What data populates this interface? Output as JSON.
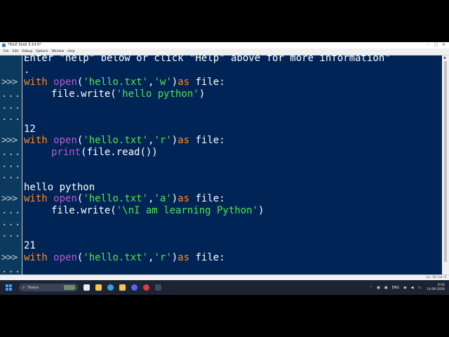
{
  "window": {
    "title": "*IDLE Shell 3.14.0*",
    "controls": [
      "–",
      "□",
      "✕"
    ]
  },
  "menu": [
    "File",
    "Edit",
    "Debug",
    "Options",
    "Window",
    "Help"
  ],
  "shell": {
    "prompt": ">>>",
    "continuation": "...",
    "banner": "Enter \"help\" below or click \"Help\" above for more information\"",
    "lines": {
      "l0": ".",
      "l1": {
        "kw": "with",
        "bi": "open",
        "p1": "(",
        "s1": "'hello.txt'",
        "p2": ",",
        "s2": "'w'",
        "p3": ")",
        "kw2": "as",
        "rest": " file:"
      },
      "l2": {
        "pre": "file.write(",
        "str": "'hello python'",
        "post": ")"
      },
      "l3": "12",
      "l4": {
        "kw": "with",
        "bi": "open",
        "p1": "(",
        "s1": "'hello.txt'",
        "p2": ",",
        "s2": "'r'",
        "p3": ")",
        "kw2": "as",
        "rest": " file:"
      },
      "l5": {
        "bi": "print",
        "post": "(file.read())"
      },
      "l6": "hello python",
      "l7": {
        "kw": "with",
        "bi": "open",
        "p1": "(",
        "s1": "'hello.txt'",
        "p2": ",",
        "s2": "'a'",
        "p3": ")",
        "kw2": "as",
        "rest": " file:"
      },
      "l8": {
        "pre": "file.write(",
        "str": "'\\nI am learning Python'",
        "post": ")"
      },
      "l9": "21",
      "l10": {
        "kw": "with",
        "bi": "open",
        "p1": "(",
        "s1": "'hello.txt'",
        "p2": ",",
        "s2": "'r'",
        "p3": ")",
        "kw2": "as",
        "rest": " file:"
      }
    }
  },
  "status": "Ln: 19  Col: 4",
  "taskbar": {
    "search_placeholder": "Поиск",
    "language": "ENG",
    "time": "9:56",
    "date": "14.09.2026"
  },
  "colors": {
    "shell_bg": "#012456",
    "keyword": "#ff8a1f",
    "builtin": "#b45ccb",
    "string": "#4ee64e",
    "text": "#ffffff"
  }
}
